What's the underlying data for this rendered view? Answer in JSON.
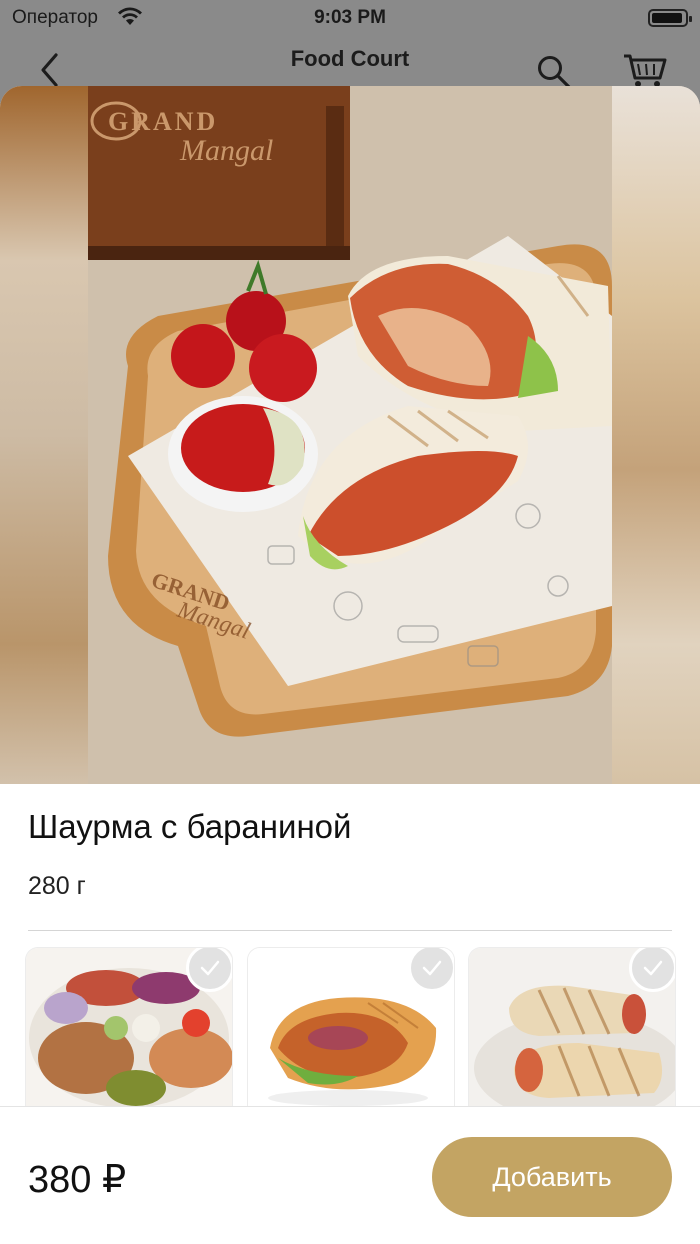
{
  "status": {
    "carrier": "Оператор",
    "time": "9:03 PM"
  },
  "nav": {
    "title": "Food Court"
  },
  "product": {
    "title": "Шаурма с бараниной",
    "weight": "280 г",
    "price": "380 ₽",
    "brand_logo_text": "GRAND Mangal"
  },
  "options": [
    {
      "name": "plate-dish",
      "selected": false
    },
    {
      "name": "pita-wrap",
      "selected": false
    },
    {
      "name": "grilled-rolls",
      "selected": false
    }
  ],
  "actions": {
    "add_label": "Добавить"
  },
  "colors": {
    "accent": "#c3a463",
    "text": "#111111",
    "divider": "#d5d5d5"
  }
}
